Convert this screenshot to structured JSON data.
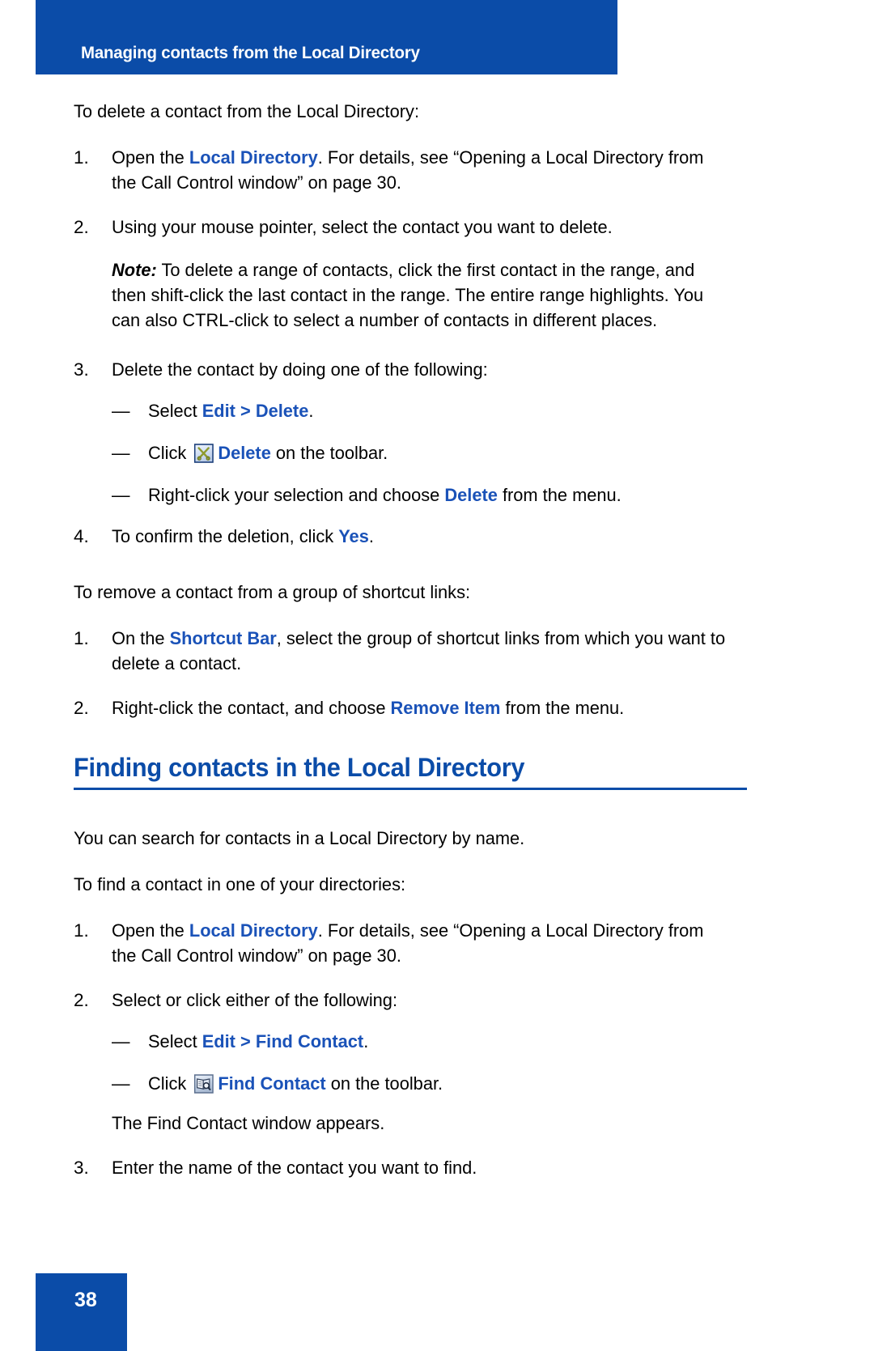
{
  "header": {
    "title": "Managing contacts from the Local Directory",
    "bar_color": "#0B4CA8"
  },
  "colors": {
    "brand_blue": "#0B4CA8",
    "ui_link_blue": "#1A52B8",
    "body_text": "#000000",
    "page_background": "#FFFFFF"
  },
  "body": {
    "intro_delete": "To delete a contact from the Local Directory:",
    "step1": {
      "num": "1.",
      "lead": "Open the ",
      "ui": "Local Directory",
      "rest": ". For details, see “Opening a Local Directory from the Call Control window” on page 30."
    },
    "step2": {
      "num": "2.",
      "text": "Using your mouse pointer, select the contact you want to delete."
    },
    "note": {
      "label": "Note:",
      "text": " To delete a range of contacts, click the first contact in the range, and then shift-click the last contact in the range. The entire range highlights. You can also CTRL-click to select a number of contacts in different places."
    },
    "step3": {
      "num": "3.",
      "text": "Delete the contact by doing one of the following:"
    },
    "bullet_edit_delete": {
      "dash": "—",
      "lead": "Select ",
      "ui": "Edit > Delete",
      "rest": "."
    },
    "bullet_toolbar_delete": {
      "dash": "—",
      "lead": "Click ",
      "icon": "delete-toolbar-icon",
      "ui": "Delete",
      "rest": " on the toolbar."
    },
    "bullet_rightclick_delete": {
      "dash": "—",
      "lead": "Right-click your selection and choose ",
      "ui": "Delete",
      "rest": " from the menu."
    },
    "step4": {
      "num": "4.",
      "lead": "To confirm the deletion, click ",
      "ui": "Yes",
      "rest": "."
    },
    "intro_remove": "To remove a contact from a group of shortcut links:",
    "remove_step1": {
      "num": "1.",
      "lead": "On the ",
      "ui": "Shortcut Bar",
      "rest": ", select the group of shortcut links from which you want to delete a contact."
    },
    "remove_step2": {
      "num": "2.",
      "lead": "Right-click the contact, and choose ",
      "ui": "Remove Item",
      "rest": " from the menu."
    }
  },
  "section": {
    "heading": "Finding contacts in the Local Directory",
    "intro": "You can search for contacts in a Local Directory by name.",
    "lead_in": "To find a contact in one of your directories:",
    "find_step1": {
      "num": "1.",
      "lead": "Open the ",
      "ui": "Local Directory",
      "rest": ". For details, see “Opening a Local Directory from the Call Control window” on page 30."
    },
    "find_step2": {
      "num": "2.",
      "text": "Select or click either of the following:"
    },
    "bullet_edit_find": {
      "dash": "—",
      "lead": "Select ",
      "ui": "Edit > Find Contact",
      "rest": "."
    },
    "bullet_toolbar_find": {
      "dash": "—",
      "lead": "Click ",
      "icon": "find-contact-toolbar-icon",
      "ui": "Find Contact",
      "rest": " on the toolbar."
    },
    "window_appears": "The Find Contact window appears.",
    "find_step3": {
      "num": "3.",
      "text": "Enter the name of the contact you want to find."
    }
  },
  "footer": {
    "page_number": "38"
  }
}
